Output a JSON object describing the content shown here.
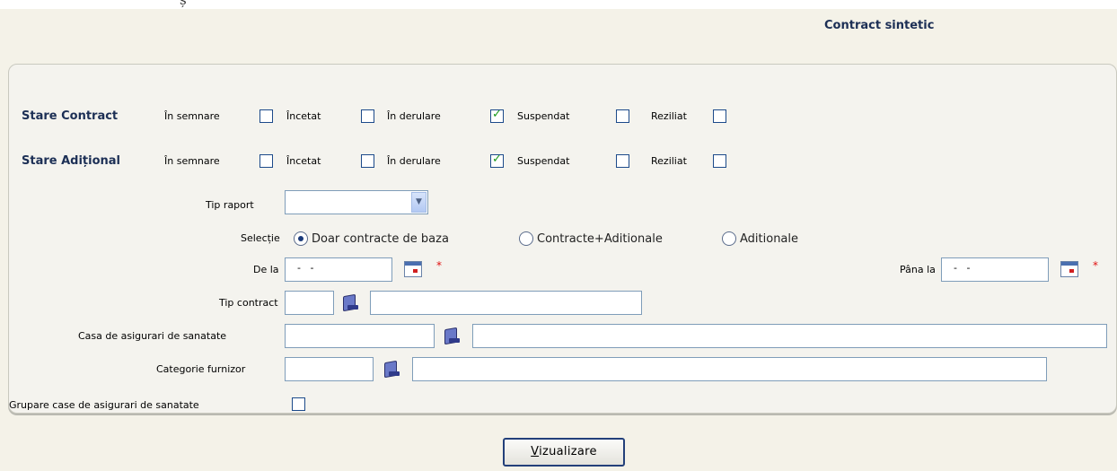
{
  "page": {
    "clipped_header_text": "ș",
    "report_title": "Contract sintetic"
  },
  "status_rows": {
    "contract_label": "Stare Contract",
    "aditional_label": "Stare Adițional",
    "options": [
      {
        "label": "În semnare",
        "contract_checked": false,
        "aditional_checked": false
      },
      {
        "label": "Încetat",
        "contract_checked": false,
        "aditional_checked": false
      },
      {
        "label": "În derulare",
        "contract_checked": true,
        "aditional_checked": true
      },
      {
        "label": "Suspendat",
        "contract_checked": false,
        "aditional_checked": false
      },
      {
        "label": "Reziliat",
        "contract_checked": false,
        "aditional_checked": false
      }
    ]
  },
  "form": {
    "tip_raport_label": "Tip raport",
    "tip_raport_value": "",
    "selectie_label": "Selecție",
    "selectie_options": [
      "Doar contracte de baza",
      "Contracte+Aditionale",
      "Aditionale"
    ],
    "selectie_selected": 0,
    "de_la_label": "De la",
    "de_la_value": "  -   -",
    "pana_la_label": "Pâna la",
    "pana_la_value": "  -   -",
    "required_mark": "*",
    "tip_contract_label": "Tip contract",
    "casa_label": "Casa de asigurari de sanatate",
    "categorie_label": "Categorie furnizor",
    "grupare_label": "Grupare case de asigurari de sanatate",
    "grupare_checked": false
  },
  "button": {
    "vizualizare_first": "V",
    "vizualizare_rest": "izualizare"
  },
  "colors": {
    "heading": "#1c2f55",
    "panel_bg": "#f4f3ee",
    "check_green": "#1a9a1a",
    "required_red": "#e01010"
  }
}
